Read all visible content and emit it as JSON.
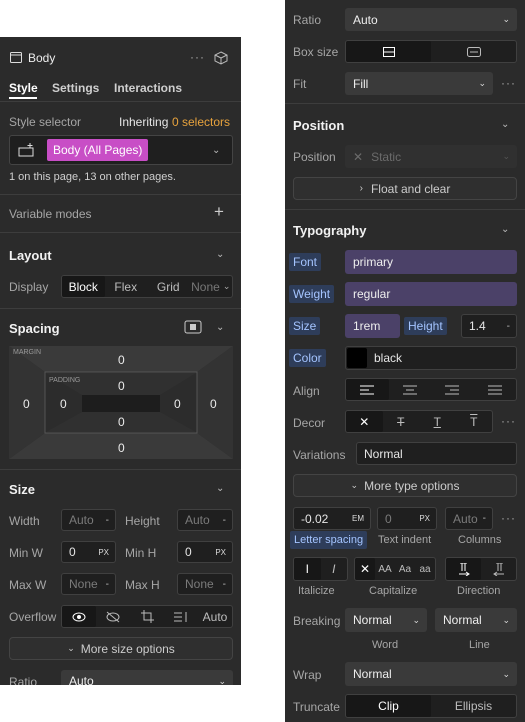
{
  "left": {
    "header": {
      "title": "Body"
    },
    "tabs": [
      "Style",
      "Settings",
      "Interactions"
    ],
    "style_selector": {
      "label": "Style selector",
      "inheriting": "Inheriting",
      "count": "0 selectors",
      "tag": "Body (All Pages)",
      "usage": "1 on this page, 13 on other pages."
    },
    "variable_modes": "Variable modes",
    "layout": {
      "title": "Layout",
      "display_label": "Display",
      "options": [
        "Block",
        "Flex",
        "Grid",
        "None"
      ]
    },
    "spacing": {
      "title": "Spacing",
      "margin_label": "MARGIN",
      "padding_label": "PADDING",
      "margin": {
        "top": "0",
        "right": "0",
        "bottom": "0",
        "left": "0"
      },
      "padding": {
        "top": "0",
        "right": "0",
        "bottom": "0",
        "left": "0"
      }
    },
    "size": {
      "title": "Size",
      "width_label": "Width",
      "width": "Auto",
      "height_label": "Height",
      "height": "Auto",
      "minw_label": "Min W",
      "minw": "0",
      "minh_label": "Min H",
      "minh": "0",
      "maxw_label": "Max W",
      "maxw": "None",
      "maxh_label": "Max H",
      "maxh": "None",
      "unit": "PX",
      "overflow_label": "Overflow",
      "overflow_auto": "Auto",
      "more": "More size options",
      "ratio_label": "Ratio",
      "ratio": "Auto"
    }
  },
  "right": {
    "ratio_label": "Ratio",
    "ratio": "Auto",
    "boxsize_label": "Box size",
    "fit_label": "Fit",
    "fit": "Fill",
    "position": {
      "title": "Position",
      "label": "Position",
      "value": "Static",
      "float": "Float and clear"
    },
    "typography": {
      "title": "Typography",
      "font_label": "Font",
      "font": "primary",
      "weight_label": "Weight",
      "weight": "regular",
      "size_label": "Size",
      "size": "1rem",
      "height_label": "Height",
      "height": "1.4",
      "color_label": "Color",
      "color": "black",
      "color_swatch": "#000000",
      "align_label": "Align",
      "decor_label": "Decor",
      "variations_label": "Variations",
      "variations": "Normal",
      "more": "More type options",
      "letter_spacing": "-0.02",
      "letter_unit": "EM",
      "text_indent": "0",
      "indent_unit": "PX",
      "columns": "Auto",
      "letter_label": "Letter spacing",
      "indent_label": "Text indent",
      "columns_label": "Columns",
      "italicize_label": "Italicize",
      "capitalize_label": "Capitalize",
      "direction_label": "Direction",
      "caps": [
        "AA",
        "Aa",
        "aa"
      ],
      "breaking_label": "Breaking",
      "word": "Normal",
      "line": "Normal",
      "word_label": "Word",
      "line_label": "Line",
      "wrap_label": "Wrap",
      "wrap": "Normal",
      "truncate_label": "Truncate",
      "clip": "Clip",
      "ellipsis": "Ellipsis"
    }
  },
  "colors": {
    "purple": "#4b4168",
    "pink": "#c84ec6",
    "accent_orange": "#e8a33d",
    "blue": "#a4c4ff"
  }
}
